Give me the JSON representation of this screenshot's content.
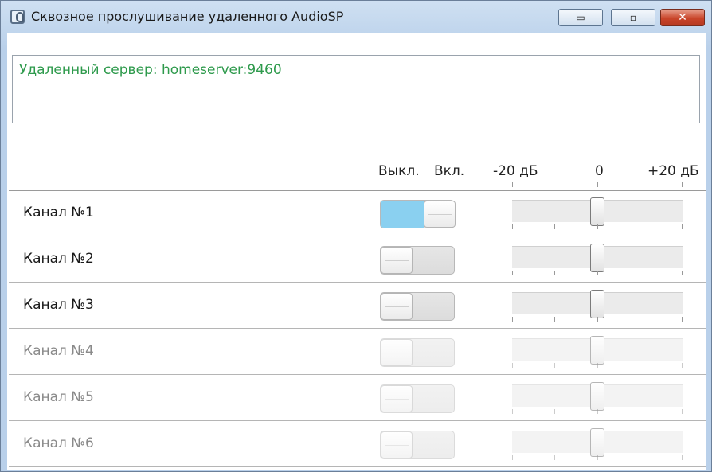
{
  "window": {
    "title": "Сквозное прослушивание удаленного AudioSP",
    "buttons": {
      "minimize": "▭",
      "maximize": "▫",
      "close": "✕"
    }
  },
  "server": {
    "text": "Удаленный сервер: homeserver:9460",
    "color": "#2e9a4c"
  },
  "header": {
    "off_label": "Выкл.",
    "on_label": "Вкл.",
    "scale_min": "-20 дБ",
    "scale_mid": "0",
    "scale_max": "+20 дБ"
  },
  "channels": [
    {
      "label": "Канал №1",
      "enabled": true,
      "state": "on",
      "gain_db": 0
    },
    {
      "label": "Канал №2",
      "enabled": true,
      "state": "off",
      "gain_db": 0
    },
    {
      "label": "Канал №3",
      "enabled": true,
      "state": "off",
      "gain_db": 0
    },
    {
      "label": "Канал №4",
      "enabled": false,
      "state": "off",
      "gain_db": 0
    },
    {
      "label": "Канал №5",
      "enabled": false,
      "state": "off",
      "gain_db": 0
    },
    {
      "label": "Канал №6",
      "enabled": false,
      "state": "off",
      "gain_db": 0
    }
  ],
  "gain_range_db": [
    -20,
    20
  ],
  "colors": {
    "toggle_on": "#8ad0f0",
    "close_button": "#c9452a"
  }
}
